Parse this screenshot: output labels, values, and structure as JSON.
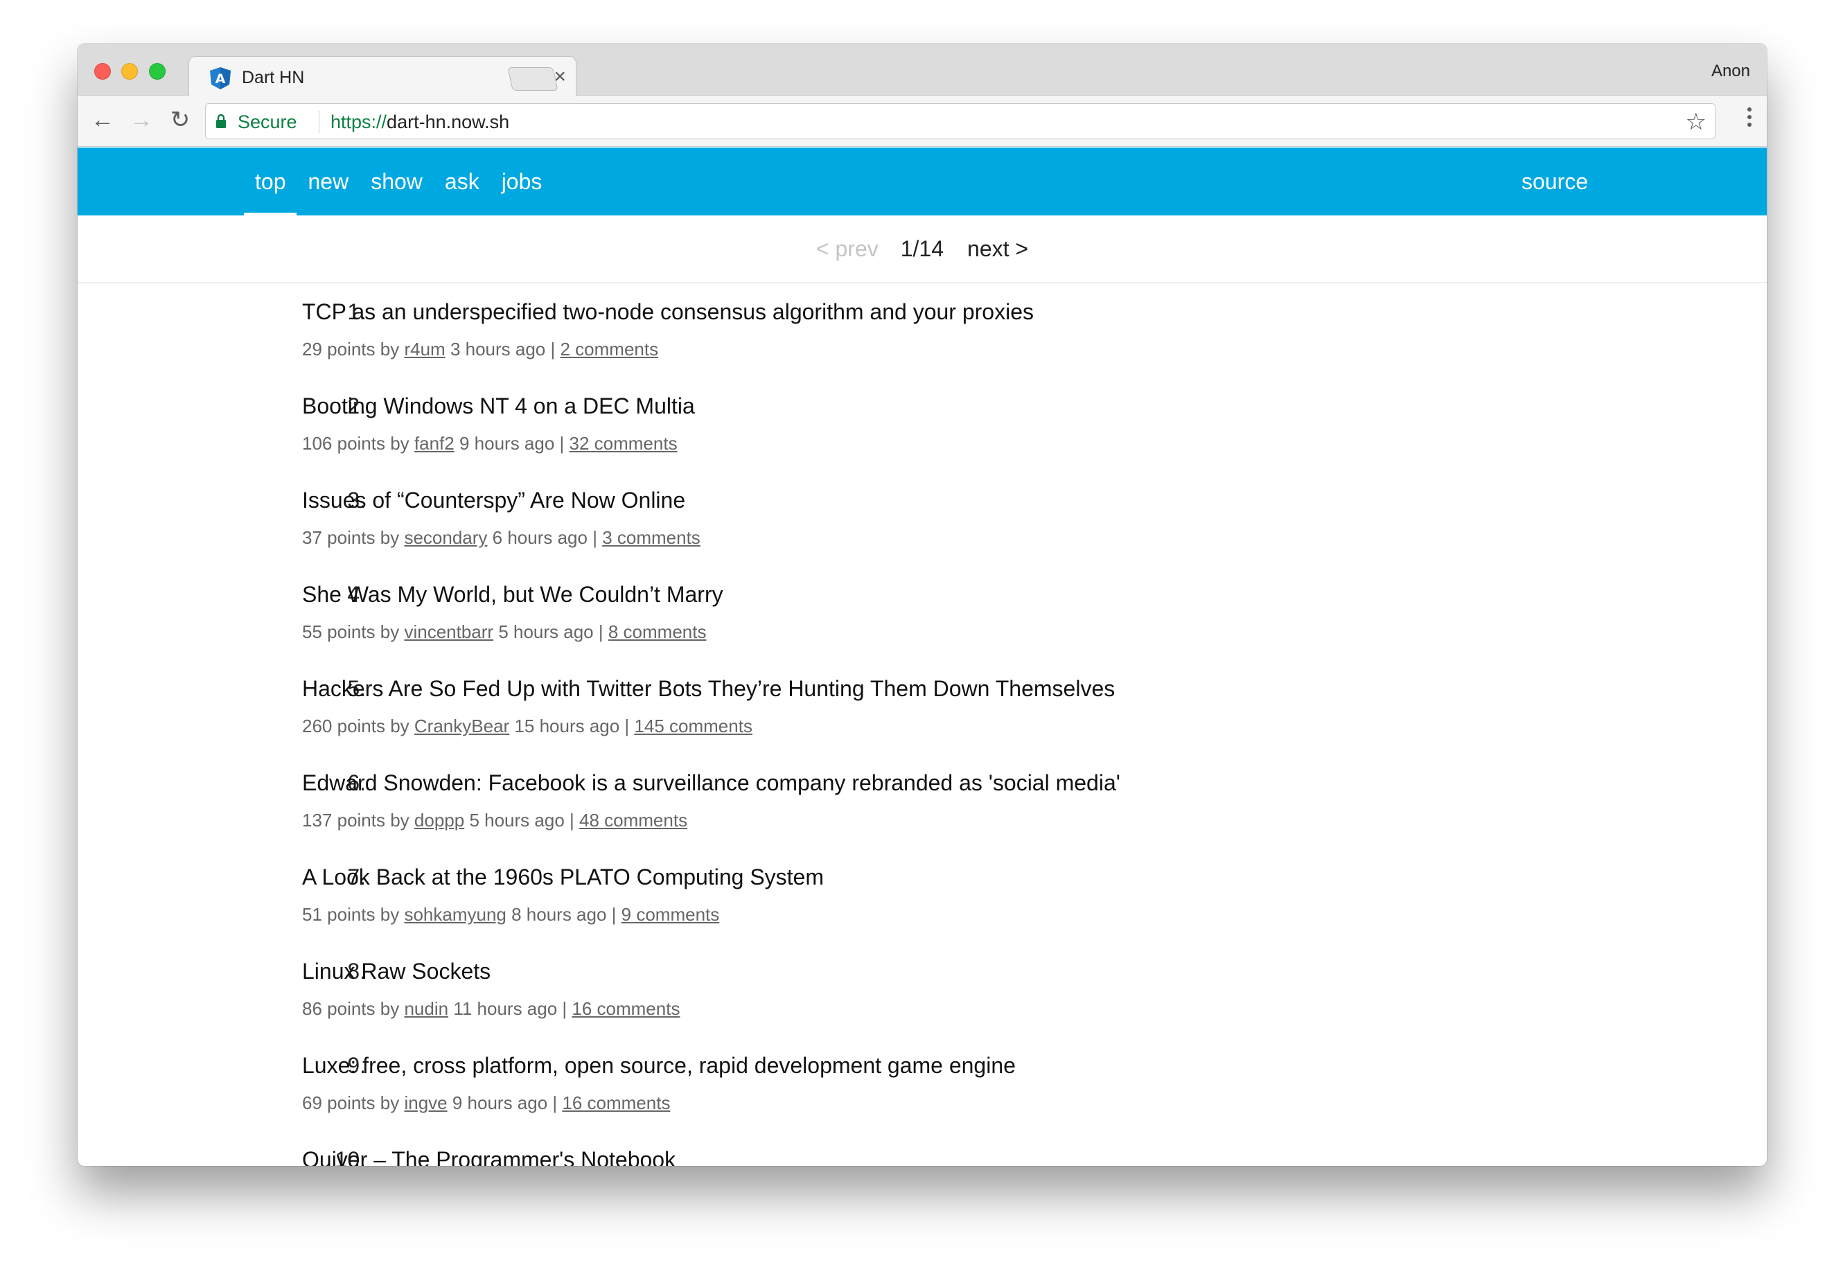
{
  "browser": {
    "tab_title": "Dart HN",
    "profile_name": "Anon",
    "secure_label": "Secure",
    "url_scheme": "https://",
    "url_host": "dart-hn.now.sh",
    "accent_secure": "#0b8043"
  },
  "app": {
    "accent": "#00a8e2",
    "nav": [
      {
        "label": "top",
        "active": true
      },
      {
        "label": "new",
        "active": false
      },
      {
        "label": "show",
        "active": false
      },
      {
        "label": "ask",
        "active": false
      },
      {
        "label": "jobs",
        "active": false
      }
    ],
    "source_label": "source"
  },
  "pager": {
    "prev_label": "< prev",
    "count": "1/14",
    "next_label": "next >"
  },
  "stories": [
    {
      "rank": "1.",
      "title": "TCP as an underspecified two-node consensus algorithm and your proxies",
      "points": "29 points by",
      "user": "r4um",
      "age": "3 hours ago |",
      "comments": "2 comments"
    },
    {
      "rank": "2.",
      "title": "Booting Windows NT 4 on a DEC Multia",
      "points": "106 points by",
      "user": "fanf2",
      "age": "9 hours ago |",
      "comments": "32 comments"
    },
    {
      "rank": "3.",
      "title": "Issues of “Counterspy” Are Now Online",
      "points": "37 points by",
      "user": "secondary",
      "age": "6 hours ago |",
      "comments": "3 comments"
    },
    {
      "rank": "4.",
      "title": "She Was My World, but We Couldn’t Marry",
      "points": "55 points by",
      "user": "vincentbarr",
      "age": "5 hours ago |",
      "comments": "8 comments"
    },
    {
      "rank": "5.",
      "title": "Hackers Are So Fed Up with Twitter Bots They’re Hunting Them Down Themselves",
      "points": "260 points by",
      "user": "CrankyBear",
      "age": "15 hours ago |",
      "comments": "145 comments"
    },
    {
      "rank": "6.",
      "title": "Edward Snowden: Facebook is a surveillance company rebranded as 'social media'",
      "points": "137 points by",
      "user": "doppp",
      "age": "5 hours ago |",
      "comments": "48 comments"
    },
    {
      "rank": "7.",
      "title": "A Look Back at the 1960s PLATO Computing System",
      "points": "51 points by",
      "user": "sohkamyung",
      "age": "8 hours ago |",
      "comments": "9 comments"
    },
    {
      "rank": "8.",
      "title": "Linux Raw Sockets",
      "points": "86 points by",
      "user": "nudin",
      "age": "11 hours ago |",
      "comments": "16 comments"
    },
    {
      "rank": "9.",
      "title": "Luxe: free, cross platform, open source, rapid development game engine",
      "points": "69 points by",
      "user": "ingve",
      "age": "9 hours ago |",
      "comments": "16 comments"
    },
    {
      "rank": "10.",
      "title": "Quiver – The Programmer's Notebook",
      "points": "",
      "user": "",
      "age": "",
      "comments": ""
    }
  ]
}
